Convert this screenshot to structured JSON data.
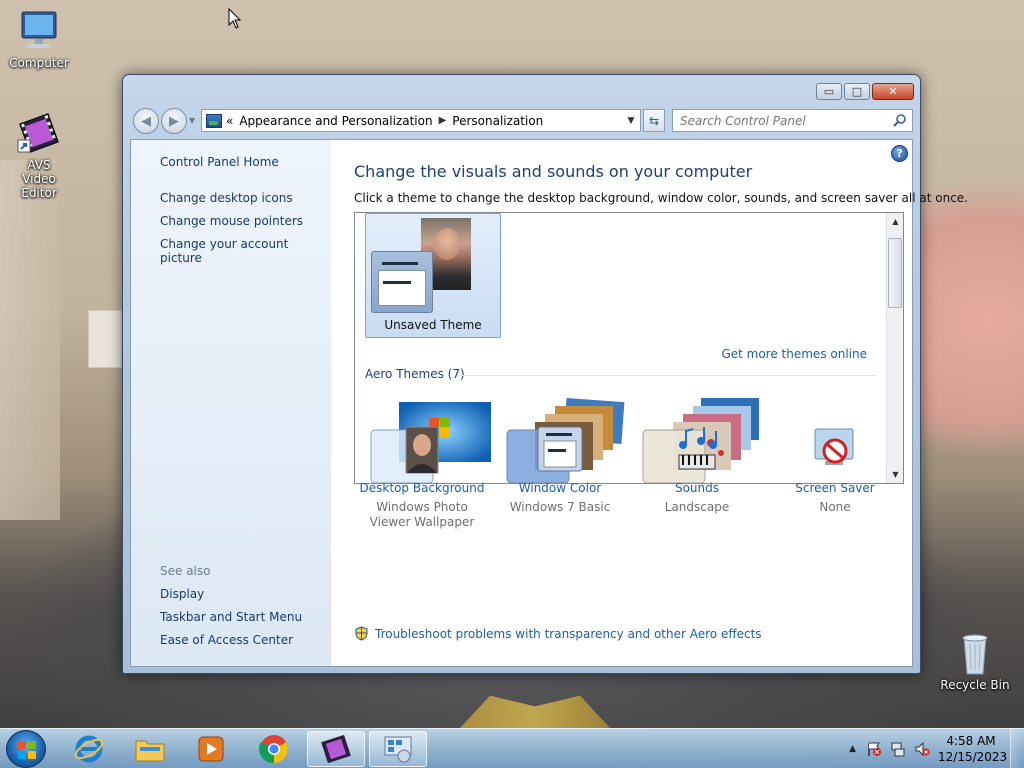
{
  "desktop": {
    "icons": [
      {
        "label": "Computer"
      },
      {
        "label": "AVS Video Editor"
      },
      {
        "label": "Recycle Bin"
      }
    ]
  },
  "window": {
    "controls": {
      "minimize": "▭",
      "maximize": "□",
      "close": "✕"
    },
    "address": {
      "prefix": "«",
      "crumbs": [
        "Appearance and Personalization",
        "Personalization"
      ]
    },
    "search_placeholder": "Search Control Panel",
    "left_pane": {
      "home": "Control Panel Home",
      "links": [
        "Change desktop icons",
        "Change mouse pointers",
        "Change your account picture"
      ],
      "see_also_header": "See also",
      "see_also": [
        "Display",
        "Taskbar and Start Menu",
        "Ease of Access Center"
      ]
    },
    "main": {
      "title": "Change the visuals and sounds on your computer",
      "subtitle": "Click a theme to change the desktop background, window color, sounds, and screen saver all at once.",
      "selected_theme": "Unsaved Theme",
      "get_more": "Get more themes online",
      "aero_header": "Aero Themes (7)"
    },
    "bottom": [
      {
        "link": "Desktop Background",
        "sub": "Windows Photo Viewer Wallpaper",
        "icon": "photo-icon"
      },
      {
        "link": "Window Color",
        "sub": "Windows 7 Basic",
        "icon": "window-color-icon"
      },
      {
        "link": "Sounds",
        "sub": "Landscape",
        "icon": "music-notes-icon"
      },
      {
        "link": "Screen Saver",
        "sub": "None",
        "icon": "screensaver-none-icon"
      }
    ],
    "troubleshoot": "Troubleshoot problems with transparency and other Aero effects"
  },
  "taskbar": {
    "clock_time": "4:58 AM",
    "clock_date": "12/15/2023"
  },
  "colors": {
    "link": "#1b5fa8",
    "title": "#1e3f78",
    "leftpane": "#dde8f5"
  }
}
